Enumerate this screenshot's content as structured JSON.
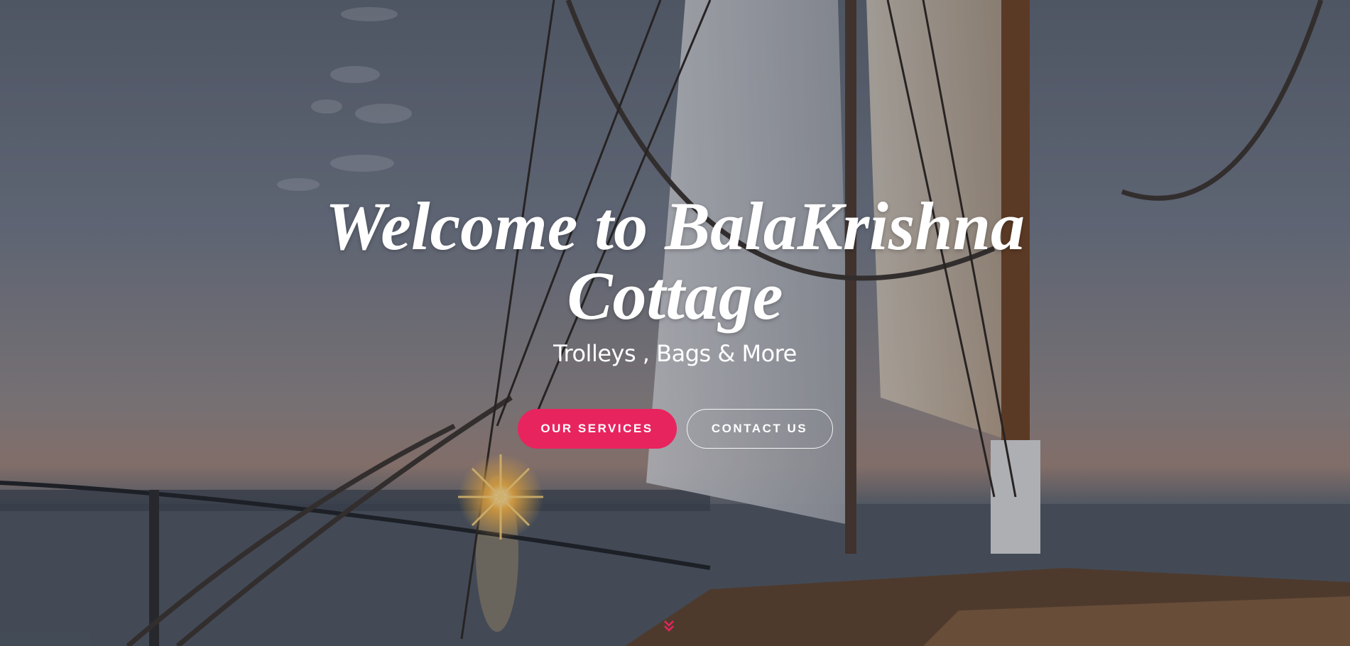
{
  "hero": {
    "title": "Welcome to BalaKrishna Cottage",
    "subtitle": "Trolleys , Bags & More",
    "buttons": {
      "primary_label": "OUR SERVICES",
      "secondary_label": "CONTACT US"
    },
    "scroll_icon": "chevron-double-down-icon",
    "background_image": "sailboat-sunset-photo"
  },
  "colors": {
    "accent": "#e8245f",
    "text": "#ffffff"
  }
}
